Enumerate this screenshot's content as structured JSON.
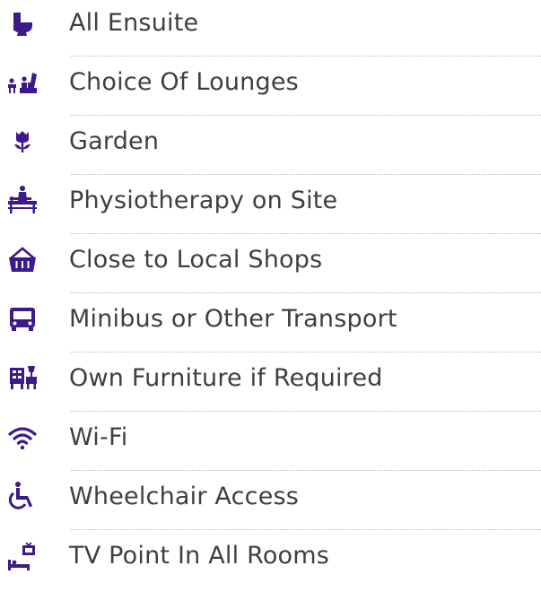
{
  "accent_color": "#3d1a8a",
  "facilities": [
    {
      "label": "All Ensuite",
      "icon": "toilet-icon"
    },
    {
      "label": "Choice Of Lounges",
      "icon": "lounge-icon"
    },
    {
      "label": "Garden",
      "icon": "flower-icon"
    },
    {
      "label": "Physiotherapy on Site",
      "icon": "physiotherapy-icon"
    },
    {
      "label": "Close to Local Shops",
      "icon": "shopping-basket-icon"
    },
    {
      "label": "Minibus or Other Transport",
      "icon": "bus-icon"
    },
    {
      "label": "Own Furniture if Required",
      "icon": "furniture-icon"
    },
    {
      "label": "Wi-Fi",
      "icon": "wifi-icon"
    },
    {
      "label": "Wheelchair Access",
      "icon": "wheelchair-icon"
    },
    {
      "label": "TV Point In All Rooms",
      "icon": "tv-bed-icon"
    }
  ]
}
